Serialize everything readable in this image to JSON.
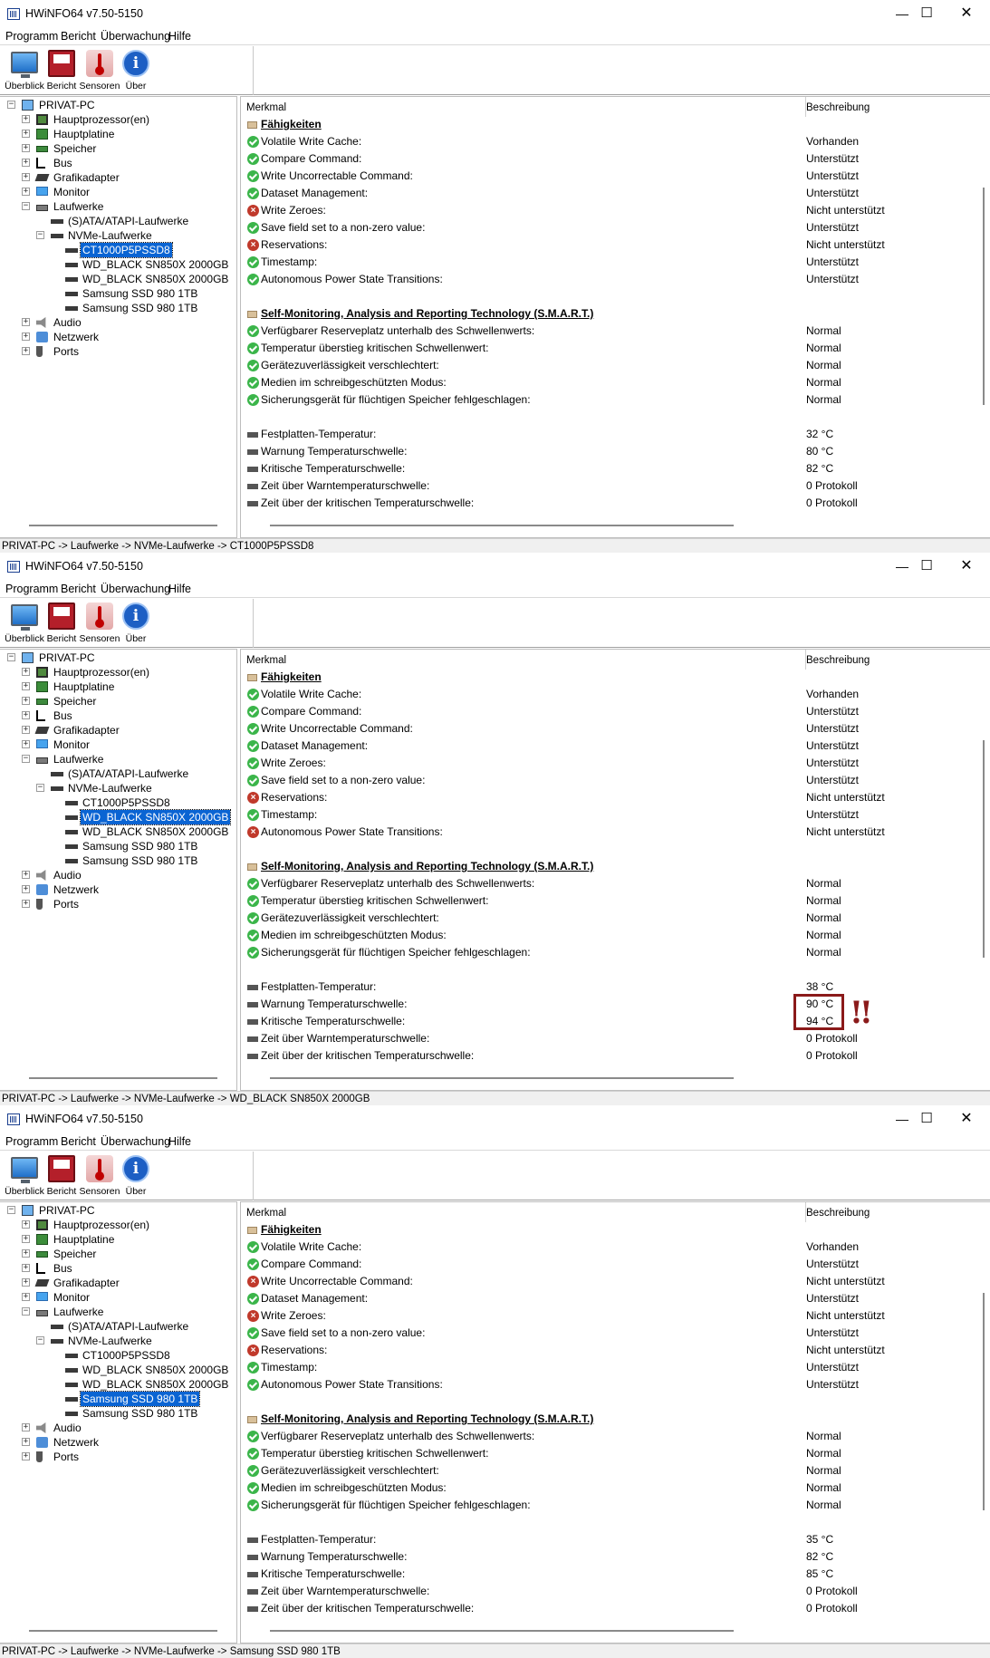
{
  "app": {
    "title": "HWiNFO64 v7.50-5150",
    "window_controls": {
      "min": "—",
      "max": "☐",
      "close": "✕"
    },
    "menu": [
      "Programm",
      "Bericht",
      "Überwachung",
      "Hilfe"
    ],
    "toolbar": [
      {
        "label": "Überblick",
        "icon": "overview-monitor-icon"
      },
      {
        "label": "Bericht",
        "icon": "report-floppy-icon"
      },
      {
        "label": "Sensoren",
        "icon": "sensors-thermometer-icon"
      },
      {
        "label": "Über",
        "icon": "about-info-icon",
        "glyph": "i"
      }
    ],
    "columns": {
      "feature": "Merkmal",
      "description": "Beschreibung"
    },
    "tree_nodes": {
      "root": "PRIVAT-PC",
      "cpu": "Hauptprozessor(en)",
      "mainboard": "Hauptplatine",
      "memory": "Speicher",
      "bus": "Bus",
      "gpu": "Grafikadapter",
      "monitor": "Monitor",
      "drives": "Laufwerke",
      "sata": "(S)ATA/ATAPI-Laufwerke",
      "nvme": "NVMe-Laufwerke",
      "drive1": "CT1000P5PSSD8",
      "drive2": "WD_BLACK SN850X 2000GB",
      "drive3": "WD_BLACK SN850X 2000GB",
      "drive4": "Samsung SSD 980 1TB",
      "drive5": "Samsung SSD 980 1TB",
      "audio": "Audio",
      "network": "Netzwerk",
      "ports": "Ports"
    },
    "expander": {
      "plus": "+",
      "minus": "−"
    },
    "labels": {
      "sec_caps": "Fähigkeiten",
      "volatile": "Volatile Write Cache:",
      "compare": "Compare Command:",
      "write_unc": "Write Uncorrectable Command:",
      "dataset": "Dataset Management:",
      "write_zero": "Write Zeroes:",
      "save_field": "Save field set to a non-zero value:",
      "reservations": "Reservations:",
      "timestamp": "Timestamp:",
      "apst": "Autonomous Power State Transitions:",
      "sec_smart": "Self-Monitoring, Analysis and Reporting Technology (S.M.A.R.T.)",
      "reserve": "Verfügbarer Reserveplatz unterhalb des Schwellenwerts:",
      "temp_exceeded": "Temperatur überstieg kritischen Schwellenwert:",
      "reliability": "Gerätezuverlässigkeit verschlechtert:",
      "readonly": "Medien im schreibgeschützten Modus:",
      "volatile_fail": "Sicherungsgerät für flüchtigen Speicher fehlgeschlagen:",
      "disk_temp": "Festplatten-Temperatur:",
      "warn_temp": "Warnung Temperaturschwelle:",
      "crit_temp": "Kritische Temperaturschwelle:",
      "time_warn": "Zeit über Warntemperaturschwelle:",
      "time_crit": "Zeit über der kritischen Temperaturschwelle:"
    },
    "values": {
      "present": "Vorhanden",
      "supported": "Unterstützt",
      "not_supported": "Nicht unterstützt",
      "normal": "Normal",
      "protocol_zero": "0 Protokoll"
    }
  },
  "windows": [
    {
      "status": "PRIVAT-PC -> Laufwerke -> NVMe-Laufwerke -> CT1000P5PSSD8",
      "selected": "drive1",
      "caps": [
        "ok",
        "ok",
        "ok",
        "ok",
        "no",
        "ok",
        "no",
        "ok",
        "ok"
      ],
      "caps_values": [
        "Vorhanden",
        "Unterstützt",
        "Unterstützt",
        "Unterstützt",
        "Nicht unterstützt",
        "Unterstützt",
        "Nicht unterstützt",
        "Unterstützt",
        "Unterstützt"
      ],
      "temps": {
        "disk": "32 °C",
        "warn": "80 °C",
        "crit": "82 °C"
      }
    },
    {
      "status": "PRIVAT-PC -> Laufwerke -> NVMe-Laufwerke -> WD_BLACK SN850X 2000GB",
      "selected": "drive2",
      "caps": [
        "ok",
        "ok",
        "ok",
        "ok",
        "ok",
        "ok",
        "no",
        "ok",
        "no"
      ],
      "caps_values": [
        "Vorhanden",
        "Unterstützt",
        "Unterstützt",
        "Unterstützt",
        "Unterstützt",
        "Unterstützt",
        "Nicht unterstützt",
        "Unterstützt",
        "Nicht unterstützt"
      ],
      "temps": {
        "disk": "38 °C",
        "warn": "90 °C",
        "crit": "94 °C"
      }
    },
    {
      "status": "PRIVAT-PC -> Laufwerke -> NVMe-Laufwerke -> Samsung SSD 980 1TB",
      "selected": "drive4",
      "caps": [
        "ok",
        "ok",
        "no",
        "ok",
        "no",
        "ok",
        "no",
        "ok",
        "ok"
      ],
      "caps_values": [
        "Vorhanden",
        "Unterstützt",
        "Nicht unterstützt",
        "Unterstützt",
        "Nicht unterstützt",
        "Unterstützt",
        "Nicht unterstützt",
        "Unterstützt",
        "Unterstützt"
      ],
      "temps": {
        "disk": "35 °C",
        "warn": "82 °C",
        "crit": "85 °C"
      }
    }
  ],
  "annotation": {
    "mark": "!!",
    "color": "#8b1a1a"
  },
  "colors": {
    "ok": "#3bb54a",
    "not_ok": "#c0392b",
    "selection": "#0a64d3"
  }
}
